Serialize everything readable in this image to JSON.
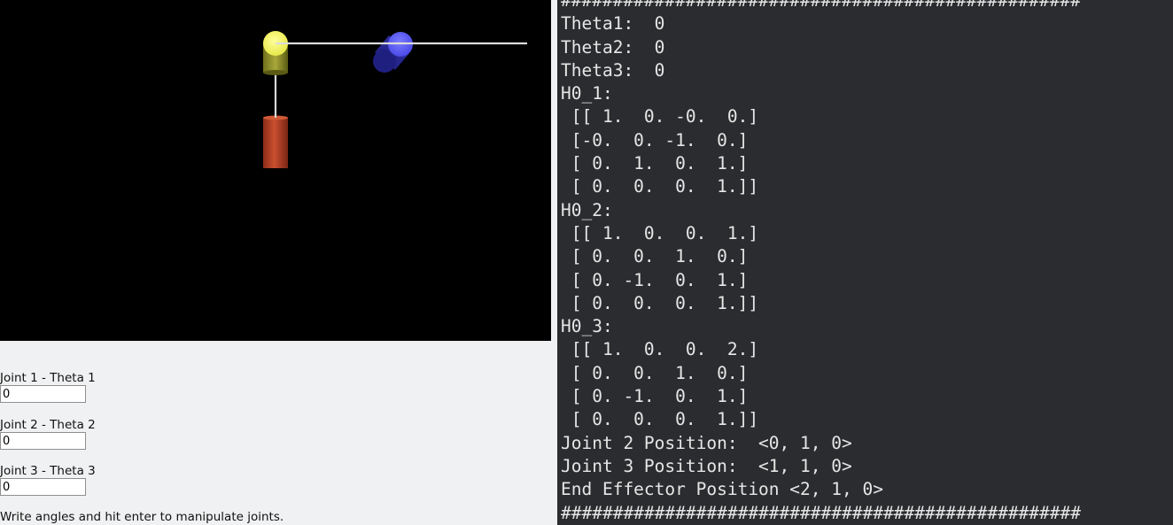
{
  "viewport": {
    "colors": {
      "background": "#000000",
      "base_link": "#c0442a",
      "joint1": "#ffff66",
      "joint2": "#5a5aff",
      "link_line": "#dcdcdc"
    }
  },
  "controls": [
    {
      "label": "Joint 1 - Theta 1",
      "value": "0"
    },
    {
      "label": "Joint 2 - Theta 2",
      "value": "0"
    },
    {
      "label": "Joint 3 - Theta 3",
      "value": "0"
    }
  ],
  "instructions": "Write angles and hit enter to manipulate joints.",
  "terminal": {
    "lines": [
      "##################################################",
      "Theta1:  0",
      "Theta2:  0",
      "Theta3:  0",
      "H0_1:",
      " [[ 1.  0. -0.  0.]",
      " [-0.  0. -1.  0.]",
      " [ 0.  1.  0.  1.]",
      " [ 0.  0.  0.  1.]]",
      "H0_2:",
      " [[ 1.  0.  0.  1.]",
      " [ 0.  0.  1.  0.]",
      " [ 0. -1.  0.  1.]",
      " [ 0.  0.  0.  1.]]",
      "H0_3:",
      " [[ 1.  0.  0.  2.]",
      " [ 0.  0.  1.  0.]",
      " [ 0. -1.  0.  1.]",
      " [ 0.  0.  0.  1.]]",
      "Joint 2 Position:  <0, 1, 0>",
      "Joint 3 Position:  <1, 1, 0>",
      "End Effector Position <2, 1, 0>",
      "##################################################"
    ],
    "colors": {
      "background": "#2b2c2f",
      "text": "#e6e6e6"
    }
  }
}
